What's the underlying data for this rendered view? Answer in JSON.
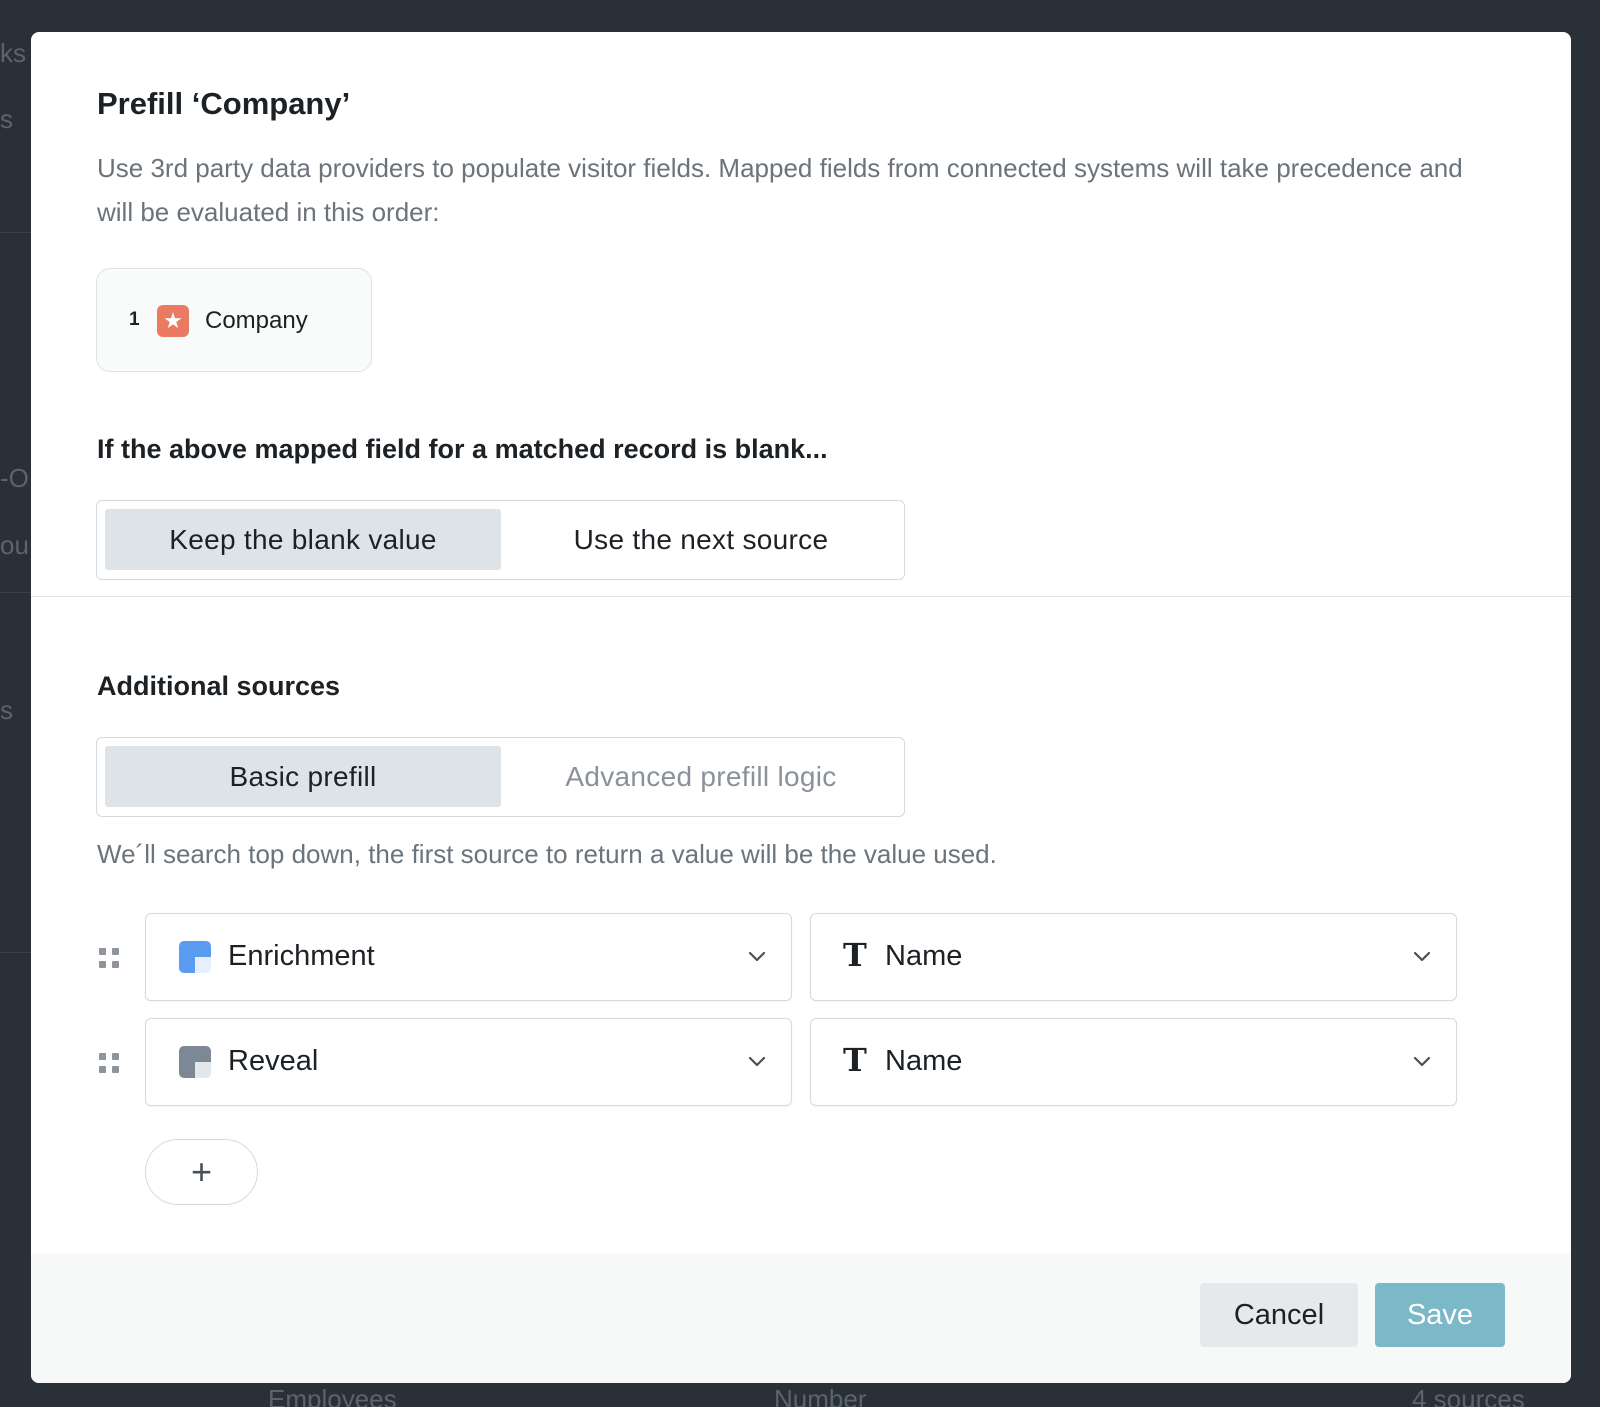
{
  "background": {
    "fragments": [
      "ks",
      "s",
      "-O",
      "ou",
      "s"
    ],
    "bottom_row": {
      "name": "Employees",
      "type": "Number",
      "sources": "4 sources"
    }
  },
  "modal": {
    "title": "Prefill ‘Company’",
    "description": "Use 3rd party data providers to populate visitor fields. Mapped fields from connected systems will take precedence and will be evaluated in this order:",
    "mapped_source": {
      "order": "1",
      "label": "Company",
      "icon": "company-logo-icon",
      "icon_color": "#ea7b62"
    },
    "blank_heading": "If the above mapped field for a matched record is blank...",
    "blank_options": [
      {
        "label": "Keep the blank value",
        "selected": true
      },
      {
        "label": "Use the next source",
        "selected": false
      }
    ],
    "additional_heading": "Additional sources",
    "prefill_modes": [
      {
        "label": "Basic prefill",
        "selected": true
      },
      {
        "label": "Advanced prefill logic",
        "selected": false
      }
    ],
    "hint": "We´ll search top down, the first source to return a value will be the value used.",
    "sources": [
      {
        "source": "Enrichment",
        "source_icon": "enrichment-icon",
        "source_color": "#5b9bf2",
        "field": "Name",
        "field_icon": "text-type-icon"
      },
      {
        "source": "Reveal",
        "source_icon": "reveal-icon",
        "source_color": "#7c8895",
        "field": "Name",
        "field_icon": "text-type-icon"
      }
    ],
    "add_label": "+",
    "cancel_label": "Cancel",
    "save_label": "Save",
    "save_color": "#7bb9c8"
  }
}
